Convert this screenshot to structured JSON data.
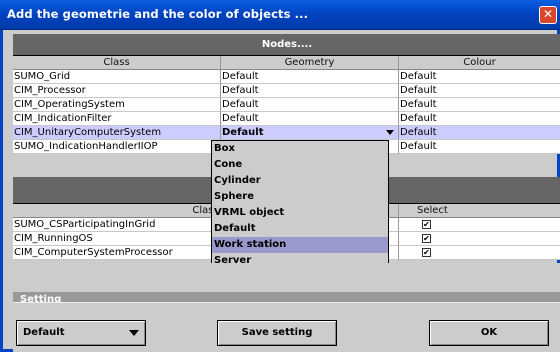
{
  "window": {
    "title": "Add the geometrie and the color of objects ..."
  },
  "nodes_section": {
    "title": "Nodes....",
    "columns": [
      "Class",
      "Geometry",
      "Colour"
    ],
    "rows": [
      {
        "class": "SUMO_Grid",
        "geometry": "Default",
        "colour": "Default"
      },
      {
        "class": "CIM_Processor",
        "geometry": "Default",
        "colour": "Default"
      },
      {
        "class": "CIM_OperatingSystem",
        "geometry": "Default",
        "colour": "Default"
      },
      {
        "class": "CIM_IndicationFilter",
        "geometry": "Default",
        "colour": "Default"
      },
      {
        "class": "CIM_UnitaryComputerSystem",
        "geometry": "Default",
        "colour": "Default",
        "selected": true
      },
      {
        "class": "SUMO_IndicationHandlerIIOP",
        "geometry": "",
        "colour": "Default"
      }
    ]
  },
  "geometry_dropdown": {
    "options": [
      "Box",
      "Cone",
      "Cylinder",
      "Sphere",
      "VRML object",
      "Default",
      "Work station",
      "Server"
    ],
    "highlighted": "Work station"
  },
  "edges_section": {
    "columns": [
      "Class",
      "Select"
    ],
    "rows": [
      {
        "class": "SUMO_CSParticipatingInGrid",
        "select": "✔"
      },
      {
        "class": "CIM_RunningOS",
        "select": "✔"
      },
      {
        "class": "CIM_ComputerSystemProcessor",
        "select": "✔"
      }
    ]
  },
  "setting": {
    "label": "Setting",
    "selected": "Default",
    "save_label": "Save setting",
    "ok_label": "OK"
  },
  "colors": {
    "titlebar": "#0244c3",
    "section_bar": "#666666",
    "selection": "#ccccff",
    "dropdown_highlight": "#9999cc"
  }
}
